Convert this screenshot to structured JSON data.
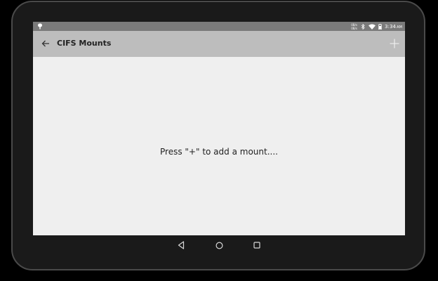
{
  "status_bar": {
    "net_speed_up": "0B/s",
    "net_speed_down": "0B/s",
    "time": "3:34",
    "ampm": "AM",
    "icons": [
      "notification-icon",
      "bluetooth-icon",
      "wifi-icon",
      "battery-icon"
    ]
  },
  "app_bar": {
    "title": "CIFS Mounts",
    "back_icon": "arrow-back-icon",
    "add_icon": "plus-icon"
  },
  "content": {
    "empty_message": "Press \"+\" to add a mount...."
  },
  "nav_bar": {
    "icons": [
      "back-triangle-icon",
      "home-circle-icon",
      "recents-square-icon"
    ]
  },
  "colors": {
    "status_bar": "#7b7b7b",
    "app_bar": "#bdbdbd",
    "background": "#efefef",
    "bezel": "#1a1a1a"
  }
}
